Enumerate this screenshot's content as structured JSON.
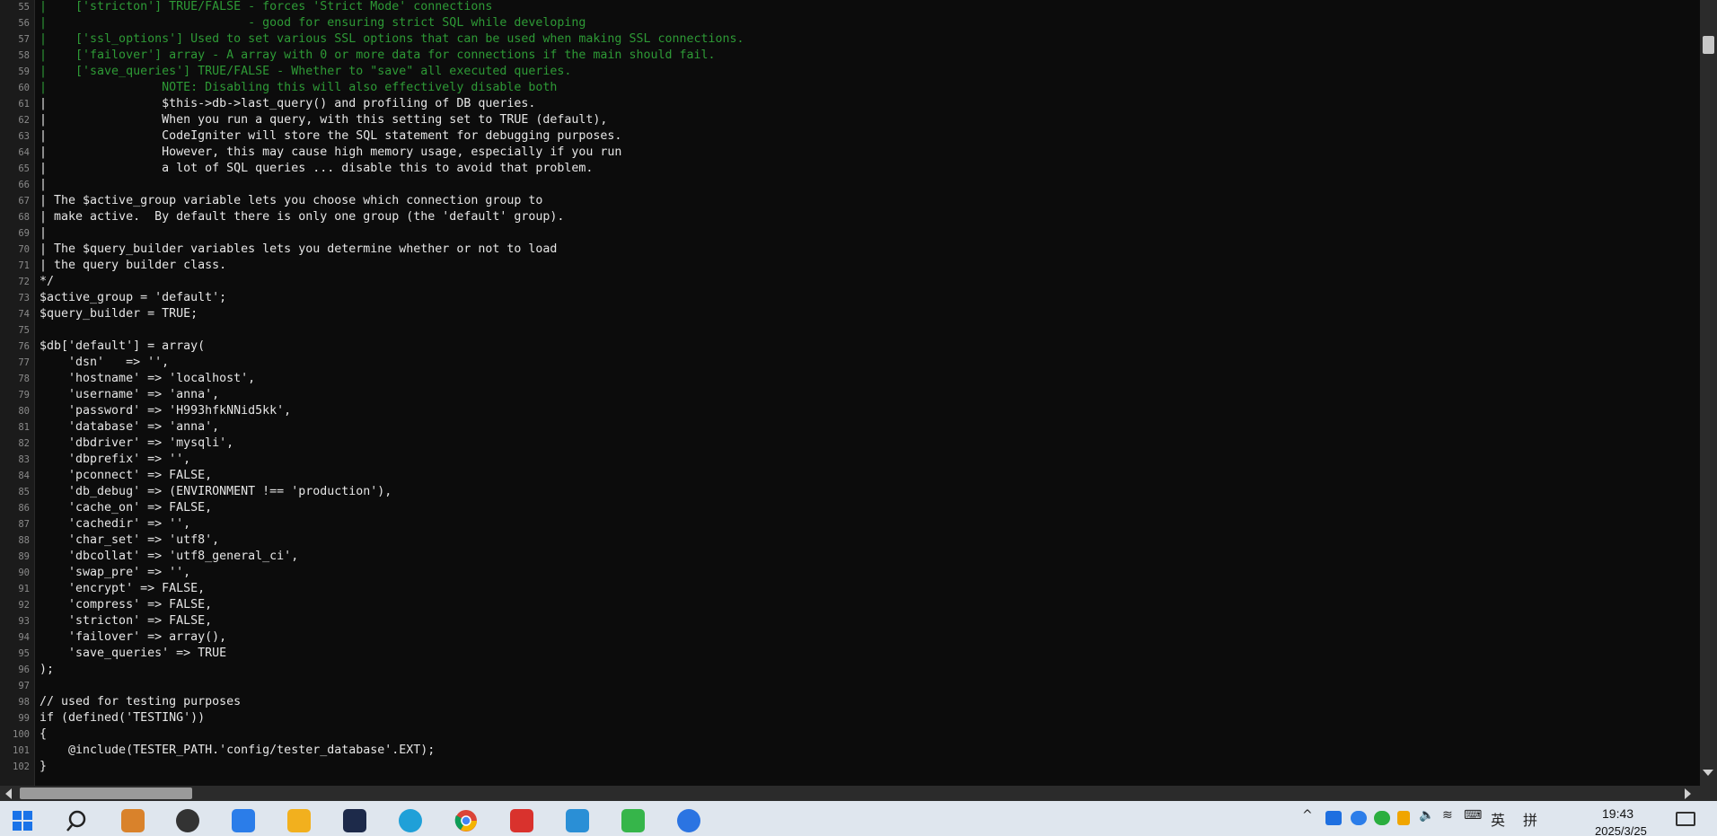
{
  "editor": {
    "lines": [
      {
        "n": "55",
        "text": "|    ['stricton'] TRUE/FALSE - forces 'Strict Mode' connections",
        "comment": true
      },
      {
        "n": "56",
        "text": "|                            - good for ensuring strict SQL while developing",
        "comment": true
      },
      {
        "n": "57",
        "text": "|    ['ssl_options'] Used to set various SSL options that can be used when making SSL connections.",
        "comment": true
      },
      {
        "n": "58",
        "text": "|    ['failover'] array - A array with 0 or more data for connections if the main should fail.",
        "comment": true
      },
      {
        "n": "59",
        "text": "|    ['save_queries'] TRUE/FALSE - Whether to \"save\" all executed queries.",
        "comment": true
      },
      {
        "n": "60",
        "text": "|                NOTE: Disabling this will also effectively disable both",
        "comment": true
      },
      {
        "n": "61",
        "text": "|                $this->db->last_query() and profiling of DB queries.",
        "comment": false
      },
      {
        "n": "62",
        "text": "|                When you run a query, with this setting set to TRUE (default),",
        "comment": false
      },
      {
        "n": "63",
        "text": "|                CodeIgniter will store the SQL statement for debugging purposes.",
        "comment": false
      },
      {
        "n": "64",
        "text": "|                However, this may cause high memory usage, especially if you run",
        "comment": false
      },
      {
        "n": "65",
        "text": "|                a lot of SQL queries ... disable this to avoid that problem.",
        "comment": false
      },
      {
        "n": "66",
        "text": "|",
        "comment": false
      },
      {
        "n": "67",
        "text": "| The $active_group variable lets you choose which connection group to",
        "comment": false
      },
      {
        "n": "68",
        "text": "| make active.  By default there is only one group (the 'default' group).",
        "comment": false
      },
      {
        "n": "69",
        "text": "|",
        "comment": false
      },
      {
        "n": "70",
        "text": "| The $query_builder variables lets you determine whether or not to load",
        "comment": false
      },
      {
        "n": "71",
        "text": "| the query builder class.",
        "comment": false
      },
      {
        "n": "72",
        "text": "*/",
        "comment": false
      },
      {
        "n": "73",
        "text": "$active_group = 'default';",
        "comment": false
      },
      {
        "n": "74",
        "text": "$query_builder = TRUE;",
        "comment": false
      },
      {
        "n": "75",
        "text": "",
        "comment": false
      },
      {
        "n": "76",
        "text": "$db['default'] = array(",
        "comment": false
      },
      {
        "n": "77",
        "text": "    'dsn'   => '',",
        "comment": false
      },
      {
        "n": "78",
        "text": "    'hostname' => 'localhost',",
        "comment": false
      },
      {
        "n": "79",
        "text": "    'username' => 'anna',",
        "comment": false
      },
      {
        "n": "80",
        "text": "    'password' => 'H993hfkNNid5kk',",
        "comment": false
      },
      {
        "n": "81",
        "text": "    'database' => 'anna',",
        "comment": false
      },
      {
        "n": "82",
        "text": "    'dbdriver' => 'mysqli',",
        "comment": false
      },
      {
        "n": "83",
        "text": "    'dbprefix' => '',",
        "comment": false
      },
      {
        "n": "84",
        "text": "    'pconnect' => FALSE,",
        "comment": false
      },
      {
        "n": "85",
        "text": "    'db_debug' => (ENVIRONMENT !== 'production'),",
        "comment": false
      },
      {
        "n": "86",
        "text": "    'cache_on' => FALSE,",
        "comment": false
      },
      {
        "n": "87",
        "text": "    'cachedir' => '',",
        "comment": false
      },
      {
        "n": "88",
        "text": "    'char_set' => 'utf8',",
        "comment": false
      },
      {
        "n": "89",
        "text": "    'dbcollat' => 'utf8_general_ci',",
        "comment": false
      },
      {
        "n": "90",
        "text": "    'swap_pre' => '',",
        "comment": false
      },
      {
        "n": "91",
        "text": "    'encrypt' => FALSE,",
        "comment": false
      },
      {
        "n": "92",
        "text": "    'compress' => FALSE,",
        "comment": false
      },
      {
        "n": "93",
        "text": "    'stricton' => FALSE,",
        "comment": false
      },
      {
        "n": "94",
        "text": "    'failover' => array(),",
        "comment": false
      },
      {
        "n": "95",
        "text": "    'save_queries' => TRUE",
        "comment": false
      },
      {
        "n": "96",
        "text": ");",
        "comment": false
      },
      {
        "n": "97",
        "text": "",
        "comment": false
      },
      {
        "n": "98",
        "text": "// used for testing purposes",
        "comment": false
      },
      {
        "n": "99",
        "text": "if (defined('TESTING'))",
        "comment": false
      },
      {
        "n": "100",
        "text": "{",
        "comment": false
      },
      {
        "n": "101",
        "text": "    @include(TESTER_PATH.'config/tester_database'.EXT);",
        "comment": false
      },
      {
        "n": "102",
        "text": "}",
        "comment": false
      }
    ]
  },
  "colors": {
    "background": "#0c0c0c",
    "code_text": "#e6e6e6",
    "comment_text": "#2e9a36",
    "gutter_text": "#8a8a8a",
    "taskbar": "#dfe6ee"
  },
  "taskbar": {
    "apps": [
      {
        "name": "start-icon",
        "color": "#1a73e8"
      },
      {
        "name": "search-icon",
        "color": "#222222"
      },
      {
        "name": "app-orange-icon",
        "color": "#d9822b"
      },
      {
        "name": "app-dark-icon",
        "color": "#333333"
      },
      {
        "name": "store-icon",
        "color": "#2b7de9"
      },
      {
        "name": "folder-icon",
        "color": "#f2b01e"
      },
      {
        "name": "cat-app-icon",
        "color": "#1d2a4a"
      },
      {
        "name": "edge-icon",
        "color": "#1fa0d8"
      },
      {
        "name": "chrome-icon",
        "color": "#db4437"
      },
      {
        "name": "wps-icon",
        "color": "#d9322d"
      },
      {
        "name": "window-app-icon",
        "color": "#2a8fd6"
      },
      {
        "name": "green-app-icon",
        "color": "#36b54a"
      },
      {
        "name": "k-app-icon",
        "color": "#2b74e2"
      }
    ],
    "tray": {
      "ime_lang": "英",
      "ime_mode": "拼",
      "time": "19:43",
      "date": "2025/3/25"
    }
  }
}
